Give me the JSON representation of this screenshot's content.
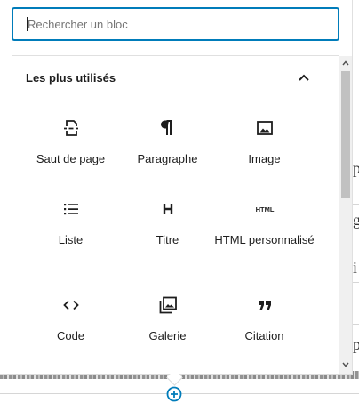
{
  "search": {
    "placeholder": "Rechercher un bloc",
    "value": ""
  },
  "panel": {
    "title": "Les plus utilisés",
    "collapse_icon": "chevron-up-icon"
  },
  "blocks": [
    {
      "label": "Saut de page",
      "icon": "page-break-icon"
    },
    {
      "label": "Paragraphe",
      "icon": "paragraph-icon"
    },
    {
      "label": "Image",
      "icon": "image-icon"
    },
    {
      "label": "Liste",
      "icon": "list-icon"
    },
    {
      "label": "Titre",
      "icon": "heading-icon"
    },
    {
      "label": "HTML personnalisé",
      "icon": "html-icon",
      "icon_text": "HTML"
    },
    {
      "label": "Code",
      "icon": "code-icon"
    },
    {
      "label": "Galerie",
      "icon": "gallery-icon"
    },
    {
      "label": "Citation",
      "icon": "quote-icon"
    }
  ],
  "colors": {
    "accent": "#007cba",
    "text": "#1e1e1e",
    "placeholder": "#757575"
  },
  "appender": {
    "icon": "plus-circle-icon"
  }
}
